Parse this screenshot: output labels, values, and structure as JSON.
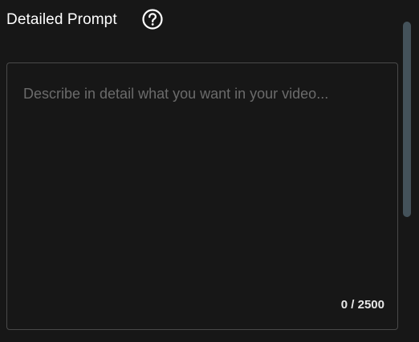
{
  "header": {
    "title": "Detailed Prompt",
    "help_icon": "question-circle-icon"
  },
  "prompt": {
    "placeholder": "Describe in detail what you want in your video...",
    "value": "",
    "counter": "0 / 2500"
  },
  "colors": {
    "background": "#171717",
    "border": "#4a4a4a",
    "scrollbar_thumb": "#44525a",
    "text": "#ffffff",
    "placeholder": "#6b6b6b"
  }
}
